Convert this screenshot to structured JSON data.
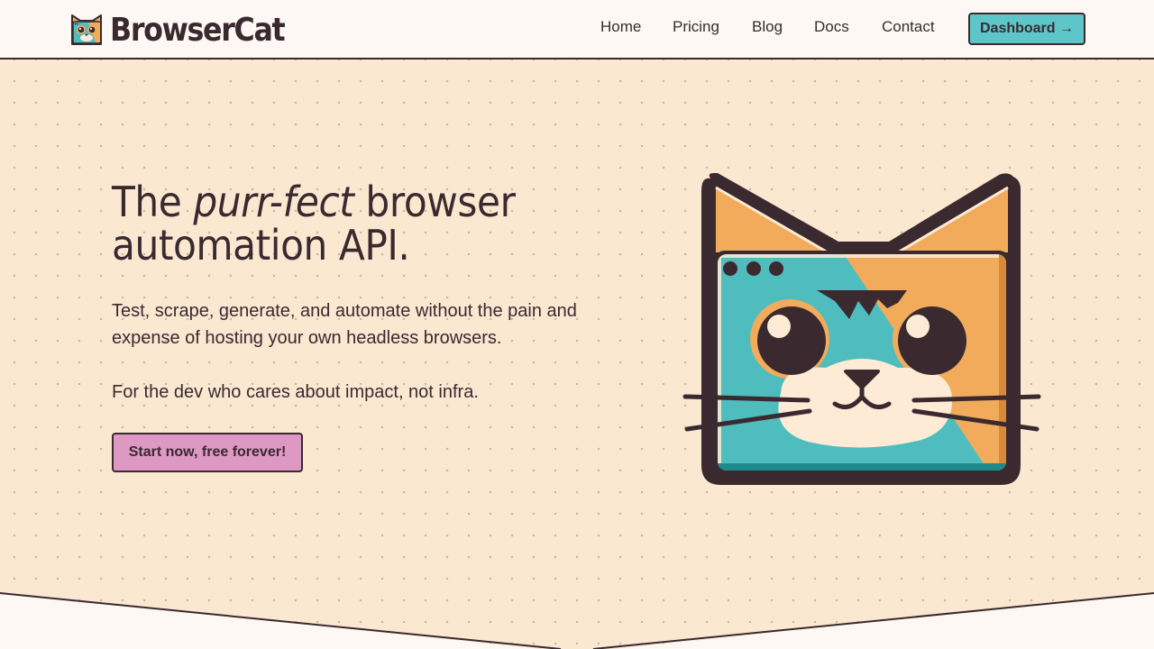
{
  "brand": {
    "name": "BrowserCat",
    "logo_icon": "cat-logo-icon"
  },
  "nav": {
    "items": [
      {
        "label": "Home"
      },
      {
        "label": "Pricing"
      },
      {
        "label": "Blog"
      },
      {
        "label": "Docs"
      },
      {
        "label": "Contact"
      }
    ],
    "dashboard_label": "Dashboard →"
  },
  "hero": {
    "title_prefix": "The ",
    "title_emphasis": "purr-fect",
    "title_suffix": " browser automation API.",
    "subtitle": "Test, scrape, generate, and automate without the pain and expense of hosting your own headless browsers.",
    "tagline": "For the dev who cares about impact, not infra.",
    "cta_label": "Start now, free forever!",
    "illustration_icon": "cat-browser-illustration-icon"
  },
  "colors": {
    "ink": "#3a2a30",
    "hero_bg": "#fae8d1",
    "page_bg": "#fdf8f3",
    "teal": "#4fbcbe",
    "orange": "#f2ab5a",
    "cream": "#fdebd6",
    "pink": "#de98c4",
    "dashboard_bg": "#5ec6c8"
  }
}
